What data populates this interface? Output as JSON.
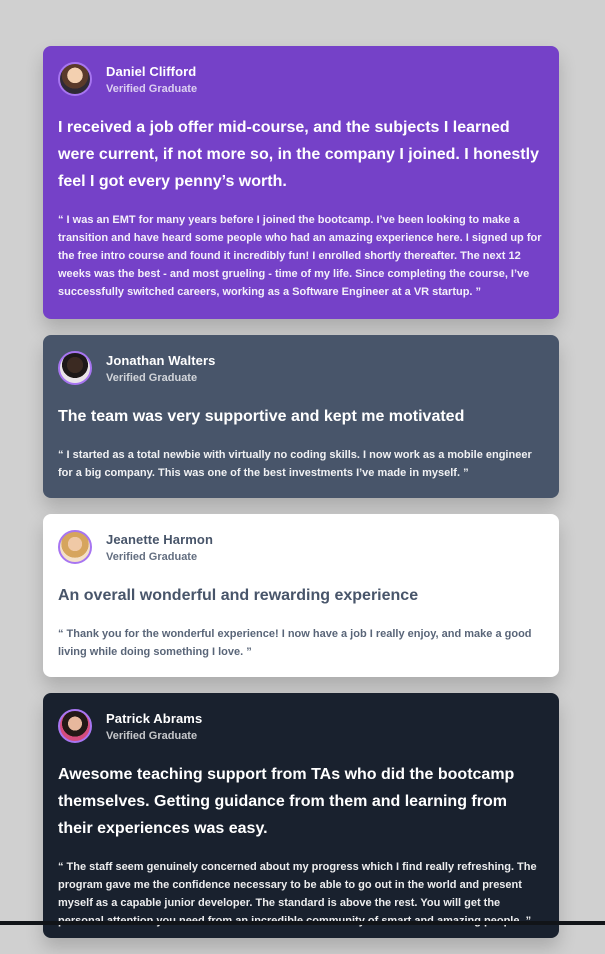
{
  "testimonials": [
    {
      "name": "Daniel Clifford",
      "role": "Verified Graduate",
      "headline": "I received a job offer mid-course, and the subjects I learned were current, if not more so, in the company I joined. I honestly feel I got every penny’s worth.",
      "quote": "“ I was an EMT for many years before I joined the bootcamp. I’ve been looking to make a transition and have heard some people who had an amazing experience here. I signed up for the free intro course and found it incredibly fun! I enrolled shortly thereafter. The next 12 weeks was the best - and most grueling - time of my life. Since completing the course, I’ve successfully switched careers, working as a Software Engineer at a VR startup. ”"
    },
    {
      "name": "Jonathan Walters",
      "role": "Verified Graduate",
      "headline": "The team was very supportive and kept me motivated",
      "quote": "“ I started as a total newbie with virtually no coding skills. I now work as a mobile engineer for a big company. This was one of the best investments I’ve made in myself. ”"
    },
    {
      "name": "Jeanette Harmon",
      "role": "Verified Graduate",
      "headline": "An overall wonderful and rewarding experience",
      "quote": "“ Thank you for the wonderful experience! I now have a job I really enjoy, and make a good living while doing something I love. ”"
    },
    {
      "name": "Patrick Abrams",
      "role": "Verified Graduate",
      "headline": "Awesome teaching support from TAs who did the bootcamp themselves. Getting guidance from them and learning from their experiences was easy.",
      "quote": "“ The staff seem genuinely concerned about my progress which I find really refreshing. The program gave me the confidence necessary to be able to go out in the world and present myself as a capable junior developer. The standard is above the rest. You will get the personal attention you need from an incredible community of smart and amazing people. ”"
    }
  ],
  "colors": {
    "background": "#d0d0d0",
    "card_purple": "#7541c8",
    "card_slate": "#48556a",
    "card_white": "#ffffff",
    "card_dark": "#19212e",
    "avatar_ring": "#a775f1"
  }
}
